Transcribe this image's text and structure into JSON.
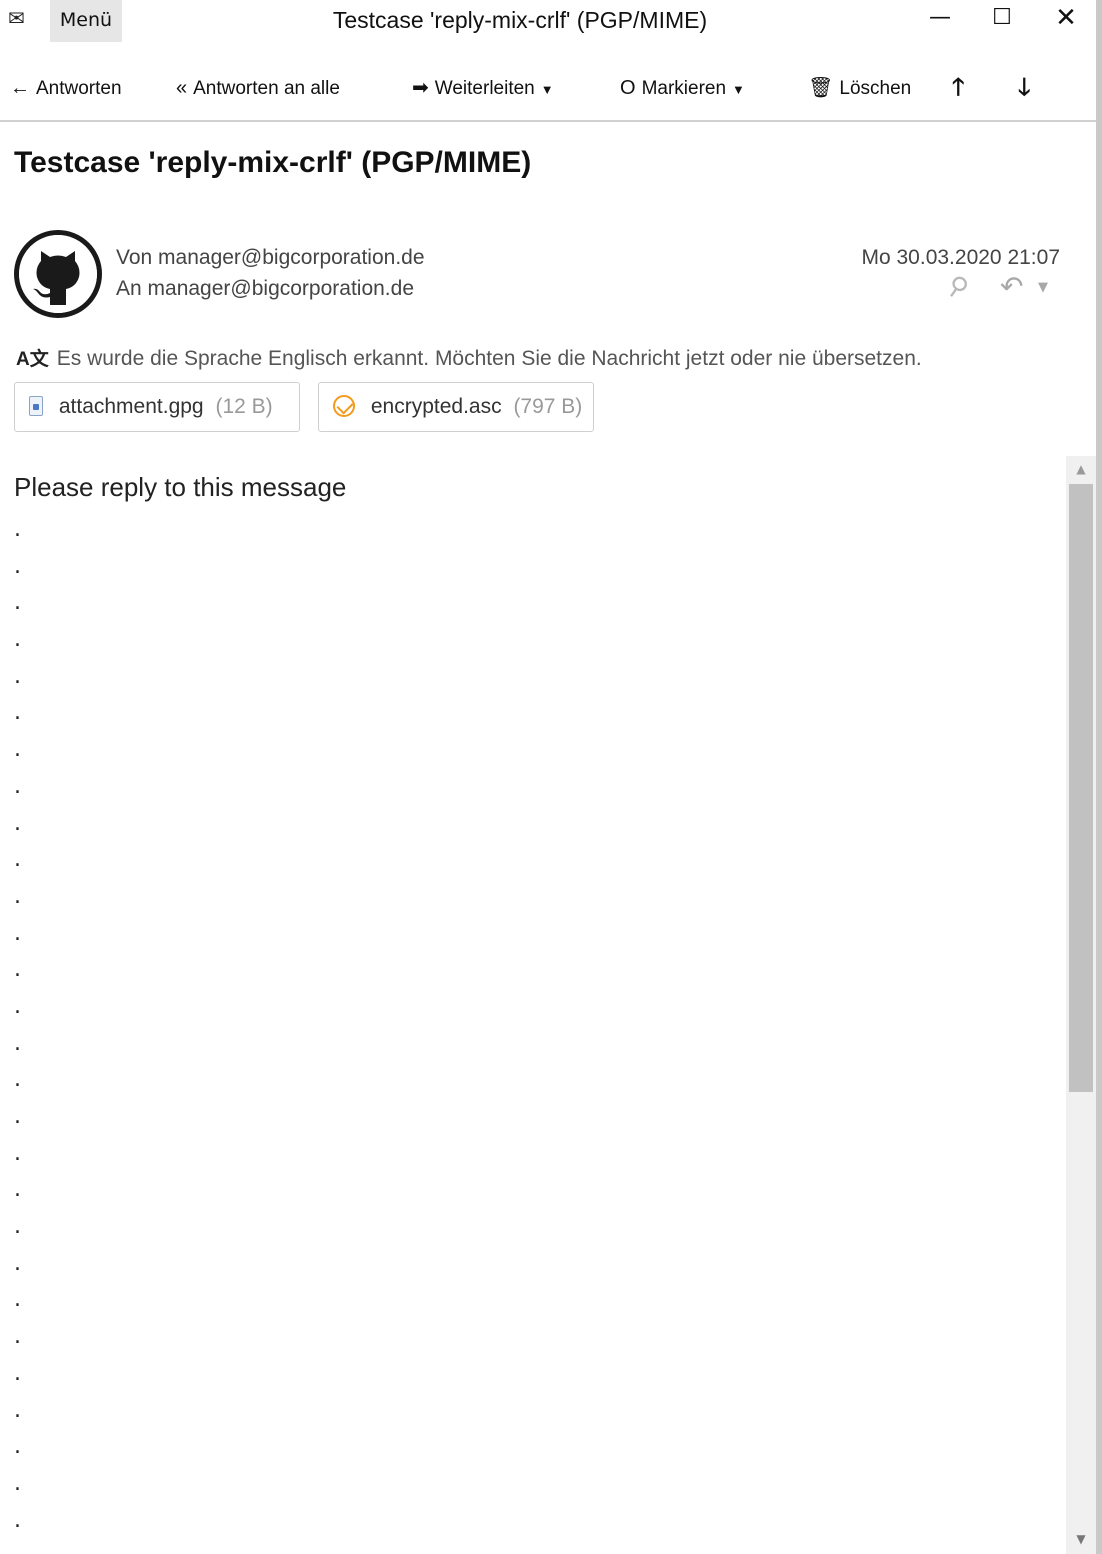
{
  "window": {
    "menu_label": "Menü",
    "title": "Testcase 'reply-mix-crlf' (PGP/MIME)",
    "minimize": "—",
    "maximize": "☐",
    "close": "✕"
  },
  "toolbar": {
    "reply_label": "Antworten",
    "reply_all_label": "Antworten an alle",
    "forward_label": "Weiterleiten",
    "mark_label": "Markieren",
    "delete_label": "Löschen",
    "reply_icon": "←",
    "reply_all_icon": "«",
    "forward_icon": "➡",
    "mark_icon": "O",
    "delete_icon": "🗑",
    "prev_icon": "🡑",
    "next_icon": "🡓"
  },
  "message": {
    "subject": "Testcase 'reply-mix-crlf' (PGP/MIME)",
    "from": "Von manager@bigcorporation.de",
    "to": "An manager@bigcorporation.de",
    "date": "Mo 30.03.2020 21:07",
    "translate_notice": "Es wurde die Sprache Englisch erkannt. Möchten Sie die Nachricht jetzt oder nie übersetzen.",
    "attachments": [
      {
        "name": "attachment.gpg",
        "size": "(12 B)"
      },
      {
        "name": "encrypted.asc",
        "size": "(797 B)"
      }
    ],
    "body_first_line": "Please reply to this message",
    "body_dot_lines": [
      ".",
      ".",
      ".",
      ".",
      ".",
      ".",
      ".",
      ".",
      ".",
      ".",
      ".",
      ".",
      ".",
      ".",
      ".",
      ".",
      ".",
      ".",
      ".",
      ".",
      ".",
      ".",
      ".",
      ".",
      ".",
      ".",
      ".",
      "."
    ]
  },
  "colors": {
    "menu_bg": "#e6e6e6",
    "pgp_orange": "#f29b1d",
    "scrollbar_thumb": "#c1c1c1"
  }
}
